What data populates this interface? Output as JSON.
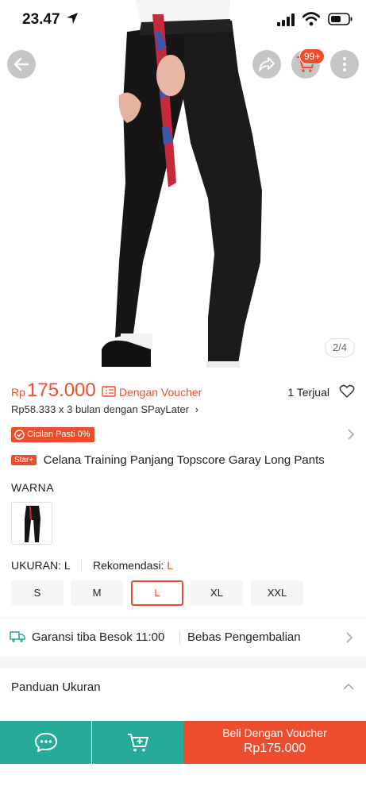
{
  "status_bar": {
    "time": "23.47"
  },
  "header": {
    "cart_badge": "99+"
  },
  "gallery": {
    "indicator": "2/4"
  },
  "price": {
    "currency": "Rp",
    "value": "175.000",
    "voucher_text": "Dengan Voucher",
    "sold": "1 Terjual",
    "installment": "Rp58.333 x 3 bulan dengan SPayLater",
    "installment_chevron": "›",
    "cicilan_badge": "Cicilan Pasti 0%"
  },
  "product": {
    "badge": "Star+",
    "title": "Celana Training Panjang Topscore Garay Long Pants"
  },
  "variation": {
    "warna_label": "WARNA",
    "ukuran_label": "UKURAN: L",
    "rekomendasi_label": "Rekomendasi:",
    "rekomendasi_value": "L",
    "sizes": [
      "S",
      "M",
      "L",
      "XL",
      "XXL"
    ],
    "selected_size": "L"
  },
  "shipping": {
    "garansi": "Garansi tiba Besok 11:00",
    "retur": "Bebas Pengembalian"
  },
  "size_guide": {
    "label": "Panduan Ukuran"
  },
  "bottom_bar": {
    "buy_line1": "Beli Dengan Voucher",
    "buy_line2": "Rp175.000"
  },
  "colors": {
    "accent": "#ee4d2d",
    "teal": "#26aa99"
  }
}
